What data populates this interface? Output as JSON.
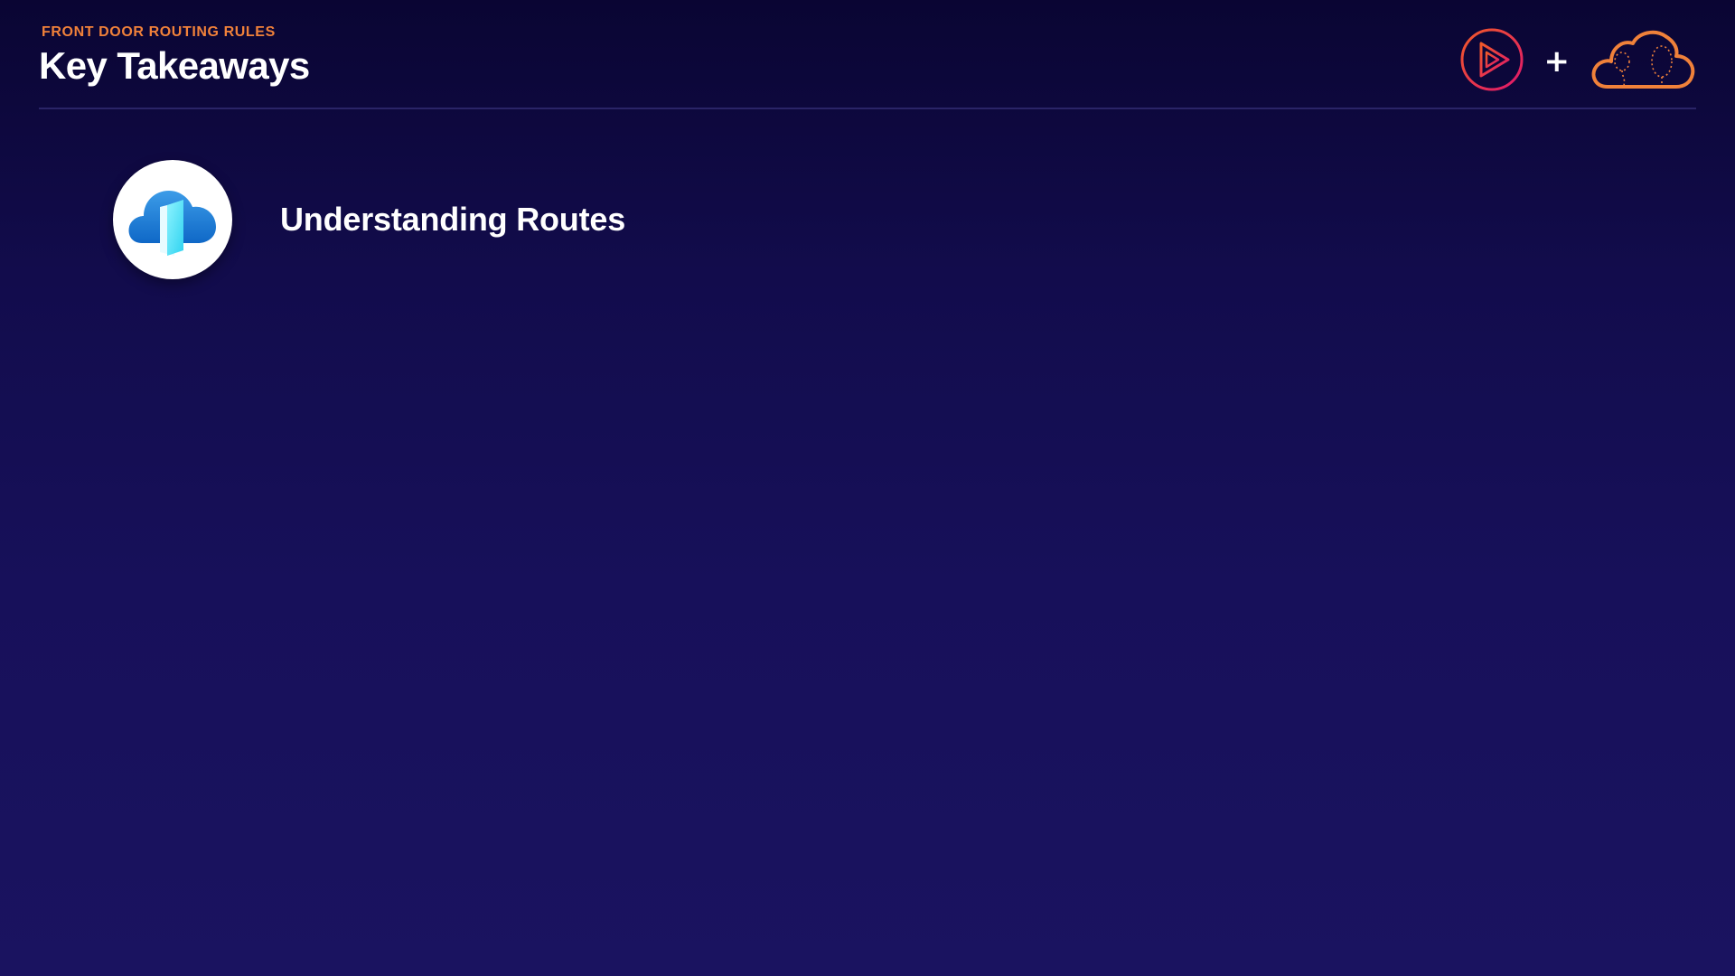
{
  "header": {
    "eyebrow": "FRONT DOOR ROUTING RULES",
    "title": "Key Takeaways"
  },
  "brand": {
    "left_logo": "play-circle-icon",
    "separator": "+",
    "right_logo": "cloud-icon",
    "colors": {
      "play_gradient_start": "#f05a28",
      "play_gradient_end": "#e0166d",
      "cloud_outline": "#f0813a"
    }
  },
  "takeaways": [
    {
      "icon": "azure-front-door-icon",
      "label": "Understanding Routes"
    }
  ],
  "colors": {
    "background_top": "#0a0533",
    "background_bottom": "#1a1360",
    "accent": "#f0813a",
    "text": "#ffffff"
  }
}
